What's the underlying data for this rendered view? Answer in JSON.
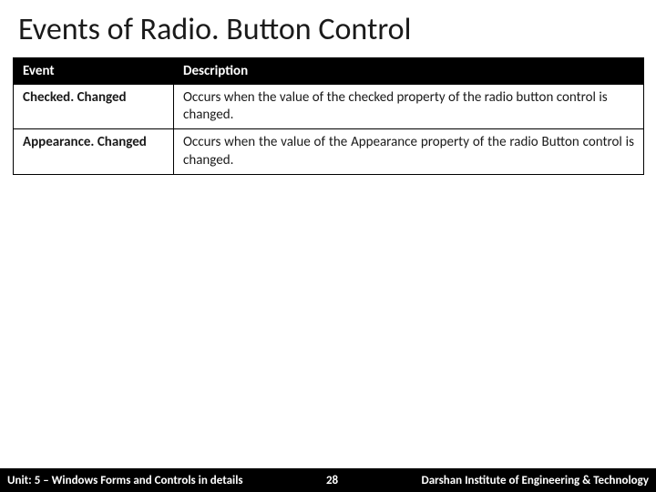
{
  "title": "Events of Radio. Button Control",
  "table": {
    "headers": {
      "col1": "Event",
      "col2": "Description"
    },
    "rows": [
      {
        "event": "Checked. Changed",
        "description": "Occurs when the value of the checked property of the radio button control is changed."
      },
      {
        "event": "Appearance. Changed",
        "description": "Occurs when the value of the Appearance property of the radio Button control is changed."
      }
    ]
  },
  "footer": {
    "unit": "Unit: 5 – Windows Forms and Controls in details",
    "page": "28",
    "org": "Darshan Institute of Engineering & Technology"
  }
}
